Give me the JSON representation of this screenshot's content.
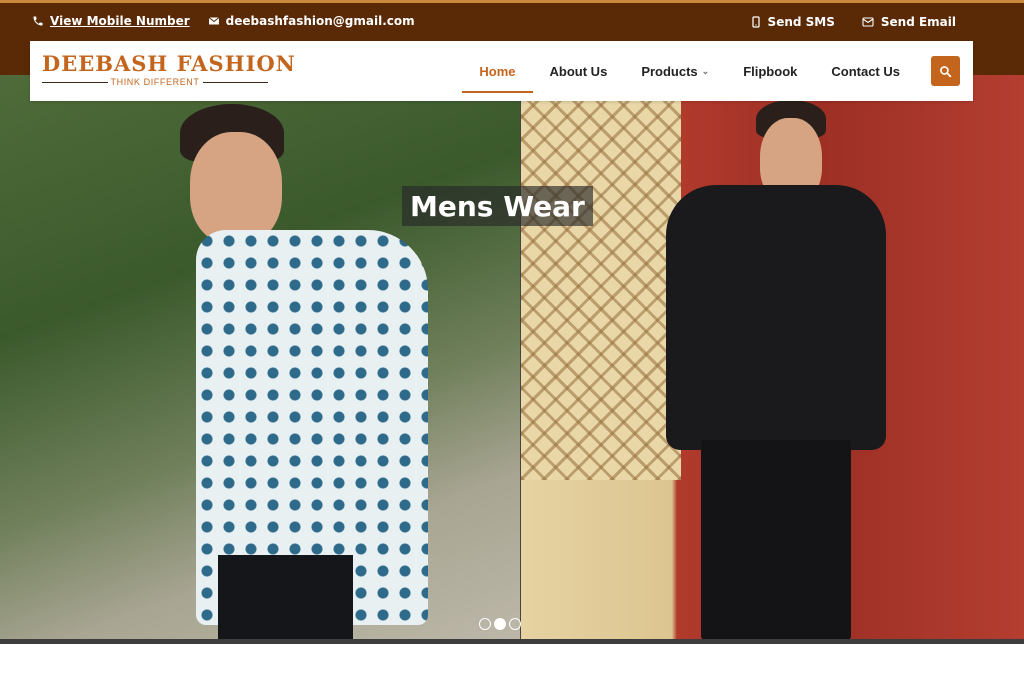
{
  "topbar": {
    "phone_label": "View Mobile Number",
    "email": "deebashfashion@gmail.com",
    "send_sms": "Send SMS",
    "send_email": "Send Email"
  },
  "logo": {
    "name": "DEEBASH FASHION",
    "tagline": "THINK DIFFERENT"
  },
  "nav": {
    "items": [
      {
        "label": "Home",
        "active": true
      },
      {
        "label": "About Us"
      },
      {
        "label": "Products",
        "has_dropdown": true
      },
      {
        "label": "Flipbook"
      },
      {
        "label": "Contact Us"
      }
    ],
    "search_icon": "search-icon"
  },
  "hero": {
    "caption": "Mens Wear",
    "slides_count": 3,
    "active_slide": 2
  },
  "colors": {
    "topbar_bg": "#5a2a06",
    "accent": "#c4651e"
  }
}
